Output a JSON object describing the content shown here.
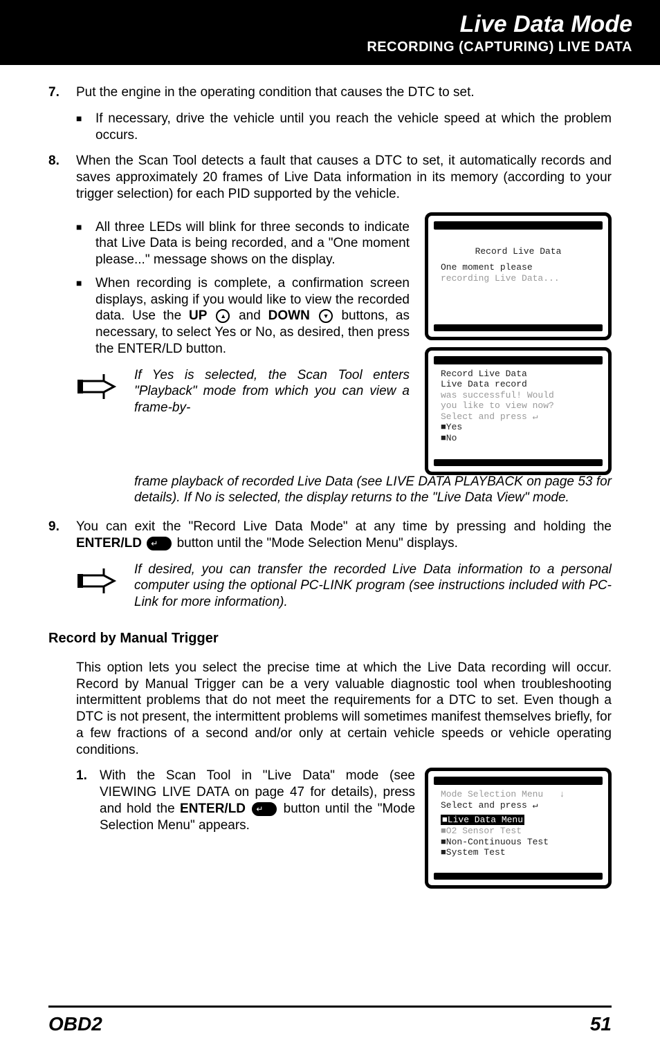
{
  "header": {
    "title": "Live Data Mode",
    "subtitle": "RECORDING (CAPTURING) LIVE DATA"
  },
  "step7": {
    "num": "7.",
    "text": "Put the engine in the operating condition that causes the DTC to set.",
    "bullet": "If necessary, drive the vehicle until you reach the vehicle speed at which the problem occurs."
  },
  "step8": {
    "num": "8.",
    "intro": "When the Scan Tool detects a fault that causes a DTC to set, it automatically records and saves approximately 20 frames of Live Data information in its memory (according to your trigger selection) for each PID supported by the vehicle.",
    "b1": "All three LEDs will blink for three seconds to indicate that Live Data is being recorded, and a \"One moment please...\" message shows on the display.",
    "b2a": "When recording is complete, a confirmation screen displays, asking if you would like to view the recorded data. Use the ",
    "b2_up": "UP",
    "b2b": " and ",
    "b2_down": "DOWN",
    "b2c": " buttons, as necessary, to select Yes or No, as desired, then press the ENTER/LD  button.",
    "note_a": "If Yes is selected, the Scan Tool enters \"Playback\" mode from which you can view a frame-by-",
    "note_b": "frame playback of recorded Live Data (see LIVE DATA PLAYBACK on page 53 for details). If No is selected, the display returns to the \"Live Data View\" mode."
  },
  "step9": {
    "num": "9.",
    "a": "You can exit the \"Record Live Data Mode\" at any time by pressing and holding the ",
    "bold": "ENTER/LD",
    "b": " button until the \"Mode Selection Menu\" displays.",
    "note": "If desired, you can transfer the recorded Live Data information to a personal computer using the optional PC-LINK program (see instructions included with PC-Link for more information)."
  },
  "section2": {
    "heading": "Record by Manual Trigger",
    "para": "This option lets you select the precise time at which the Live Data recording will occur. Record by Manual Trigger can be a very valuable diagnostic tool when troubleshooting intermittent problems that do not meet the requirements for a DTC to set. Even though a DTC is not present, the intermittent problems will sometimes manifest themselves briefly, for a few fractions of a second and/or only at certain vehicle speeds or vehicle operating conditions.",
    "s1_num": "1.",
    "s1_a": "With the Scan Tool in \"Live Data\" mode (see VIEWING LIVE DATA on page 47 for details), press and hold the ",
    "s1_bold": "ENTER/LD",
    "s1_b": " button until the \"Mode Selection Menu\" appears."
  },
  "screen1": {
    "l1": "Record Live Data",
    "l2": "One moment please",
    "l3": "recording Live Data..."
  },
  "screen2": {
    "l1": "Record Live Data",
    "l2": "Live Data record",
    "l3": "was successful! Would",
    "l4": "you like to view now?",
    "l5": "Select and press ↵",
    "l6": "■Yes",
    "l7": "■No"
  },
  "screen3": {
    "l1": "Mode Selection Menu   ↓",
    "l2": "Select and press ↵",
    "l3": "■Live Data Menu",
    "l4": "■O2 Sensor Test",
    "l5": "■Non-Continuous Test",
    "l6": "■System Test"
  },
  "footer": {
    "left": "OBD2",
    "right": "51"
  }
}
